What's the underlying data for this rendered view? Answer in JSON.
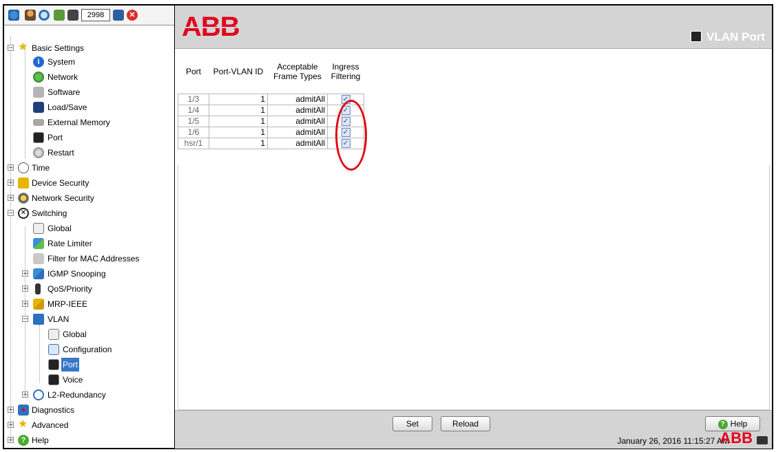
{
  "toolbar": {
    "counter_value": "2998"
  },
  "tree": {
    "basic_settings": "Basic Settings",
    "system": "System",
    "network": "Network",
    "software": "Software",
    "load_save": "Load/Save",
    "external_memory": "External Memory",
    "port": "Port",
    "restart": "Restart",
    "time": "Time",
    "device_security": "Device Security",
    "network_security": "Network Security",
    "switching": "Switching",
    "global": "Global",
    "rate_limiter": "Rate Limiter",
    "filter_mac": "Filter for MAC Addresses",
    "igmp_snooping": "IGMP Snooping",
    "qos_priority": "QoS/Priority",
    "mrp_ieee": "MRP-IEEE",
    "vlan": "VLAN",
    "vlan_global": "Global",
    "vlan_configuration": "Configuration",
    "vlan_port": "Port",
    "vlan_voice": "Voice",
    "l2_redundancy": "L2-Redundancy",
    "diagnostics": "Diagnostics",
    "advanced": "Advanced",
    "help": "Help"
  },
  "header": {
    "logo": "ABB",
    "page_title": "VLAN Port"
  },
  "table": {
    "col_port": "Port",
    "col_pvid": "Port-VLAN ID",
    "col_aft_1": "Acceptable",
    "col_aft_2": "Frame Types",
    "col_ing_1": "Ingress",
    "col_ing_2": "Filtering",
    "rows": [
      {
        "port": "1/3",
        "pvid": "1",
        "aft": "admitAll",
        "ingress": true
      },
      {
        "port": "1/4",
        "pvid": "1",
        "aft": "admitAll",
        "ingress": true
      },
      {
        "port": "1/5",
        "pvid": "1",
        "aft": "admitAll",
        "ingress": true
      },
      {
        "port": "1/6",
        "pvid": "1",
        "aft": "admitAll",
        "ingress": true
      },
      {
        "port": "hsr/1",
        "pvid": "1",
        "aft": "admitAll",
        "ingress": true
      }
    ]
  },
  "buttons": {
    "set": "Set",
    "reload": "Reload",
    "help": "Help"
  },
  "status": {
    "datetime": "January 26, 2016 11:15:27 AM",
    "logo": "ABB"
  },
  "colors": {
    "brand_red": "#e2001a",
    "annotation_red": "#e30613",
    "selection_blue": "#3878c8"
  }
}
